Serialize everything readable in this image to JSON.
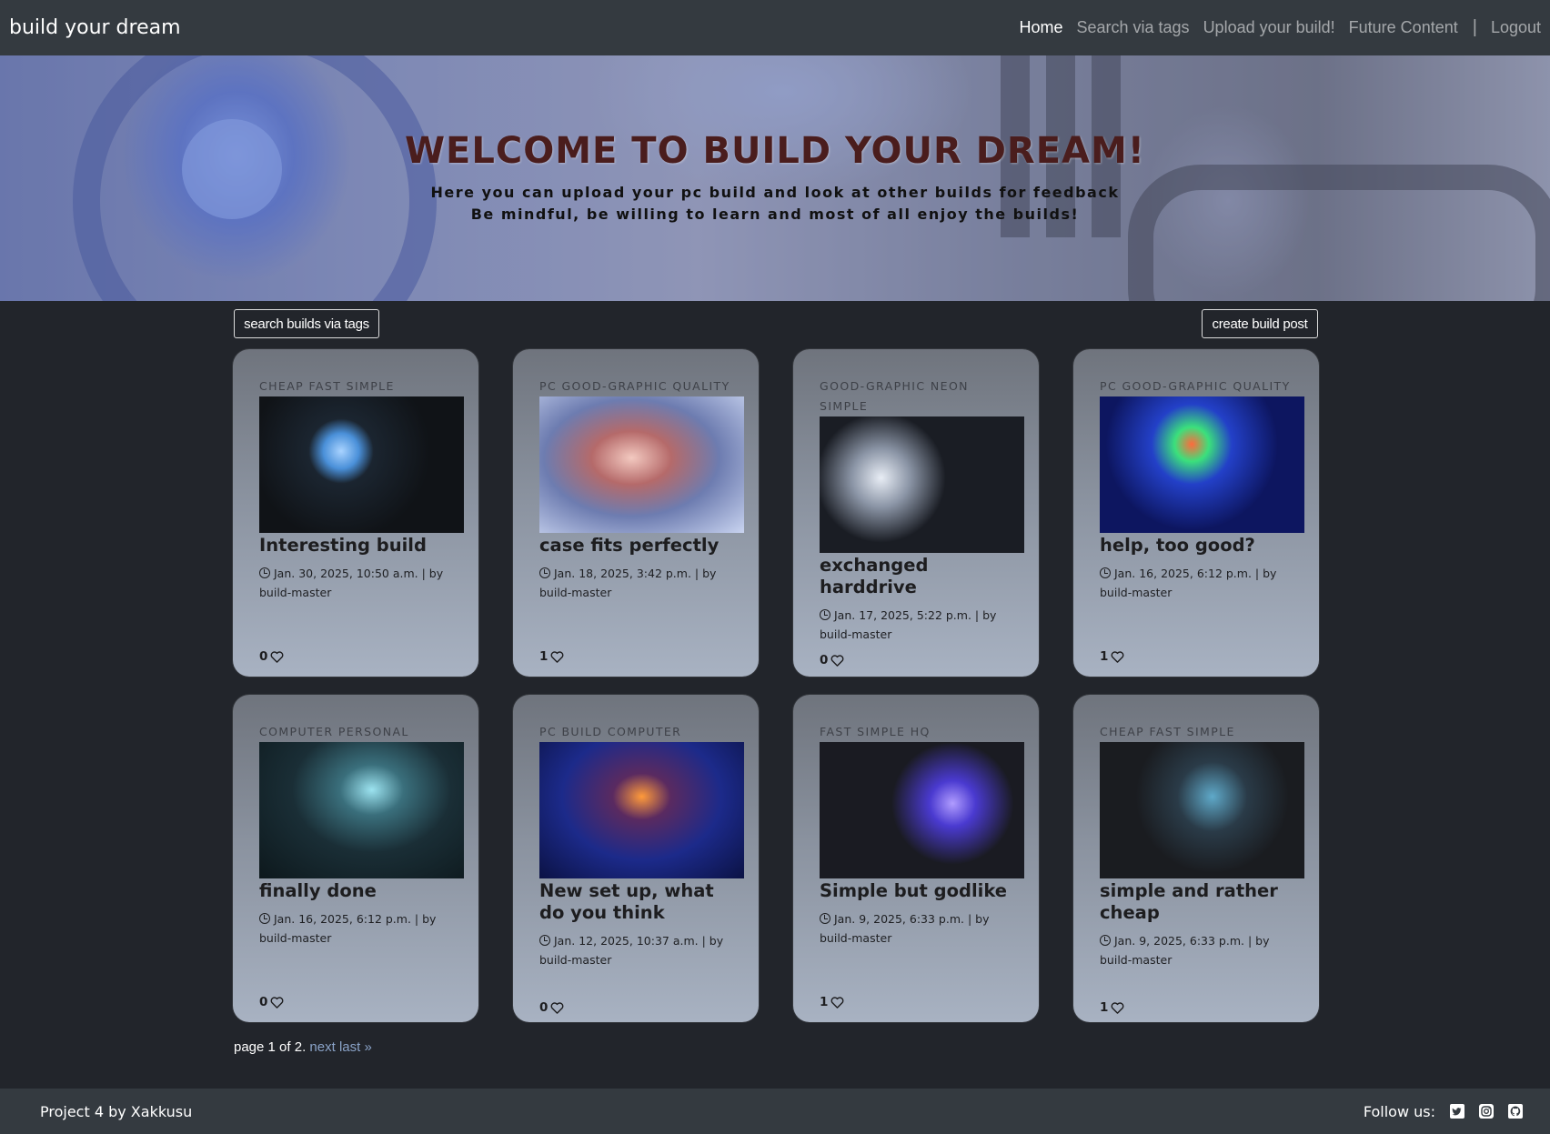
{
  "navbar": {
    "brand": "build your dream",
    "links": [
      "Home",
      "Search via tags",
      "Upload your build!",
      "Future Content"
    ],
    "separator": "|",
    "logout": "Logout"
  },
  "hero": {
    "title": "WELCOME TO BUILD YOUR DREAM!",
    "line1": "Here you can upload your pc build and look at other builds for feedback",
    "line2": "Be mindful, be willing to learn and most of all enjoy the builds!"
  },
  "actions": {
    "search_label": "search builds via tags",
    "create_label": "create build post"
  },
  "posts": [
    {
      "tags": "CHEAP FAST SIMPLE",
      "title": "Interesting build",
      "meta": "Jan. 30, 2025, 10:50 a.m. | by build-master",
      "likes": "0",
      "image": "pc-build-photo-blue-aio-cooler"
    },
    {
      "tags": "PC GOOD-GRAPHIC QUALITY",
      "title": "case fits perfectly",
      "meta": "Jan. 18, 2025, 3:42 p.m. | by build-master",
      "likes": "1",
      "image": "pc-build-photo-custom-loop"
    },
    {
      "tags": "GOOD-GRAPHIC NEON SIMPLE",
      "title": "exchanged harddrive",
      "meta": "Jan. 17, 2025, 5:22 p.m. | by build-master",
      "likes": "0",
      "image": "pc-build-photo-white-fans"
    },
    {
      "tags": "PC GOOD-GRAPHIC QUALITY",
      "title": "help, too good?",
      "meta": "Jan. 16, 2025, 6:12 p.m. | by build-master",
      "likes": "1",
      "image": "pc-build-photo-rgb-fans"
    },
    {
      "tags": "COMPUTER PERSONAL",
      "title": "finally done",
      "meta": "Jan. 16, 2025, 6:12 p.m. | by build-master",
      "likes": "0",
      "image": "pc-build-photo-dark-rog"
    },
    {
      "tags": "PC BUILD COMPUTER",
      "title": "New set up, what do you think",
      "meta": "Jan. 12, 2025, 10:37 a.m. | by build-master",
      "likes": "0",
      "image": "pc-build-photo-geforce-rtx"
    },
    {
      "tags": "FAST SIMPLE HQ",
      "title": "Simple but godlike",
      "meta": "Jan. 9, 2025, 6:33 p.m. | by build-master",
      "likes": "1",
      "image": "pc-build-photo-glass-case"
    },
    {
      "tags": "CHEAP FAST SIMPLE",
      "title": "simple and rather cheap",
      "meta": "Jan. 9, 2025, 6:33 p.m. | by build-master",
      "likes": "1",
      "image": "pc-build-photo-rtx-closeup"
    }
  ],
  "pagination": {
    "text": "page 1 of 2.",
    "next": "next",
    "last": "last »"
  },
  "footer": {
    "credit": "Project 4 by Xakkusu",
    "follow": "Follow us:",
    "icons": [
      "twitter-icon",
      "instagram-icon",
      "github-icon"
    ]
  },
  "colors": {
    "navbar": "#343a40",
    "background": "#22252b",
    "hero_title": "#4a1d1d",
    "link_muted": "#8aa3c8"
  }
}
